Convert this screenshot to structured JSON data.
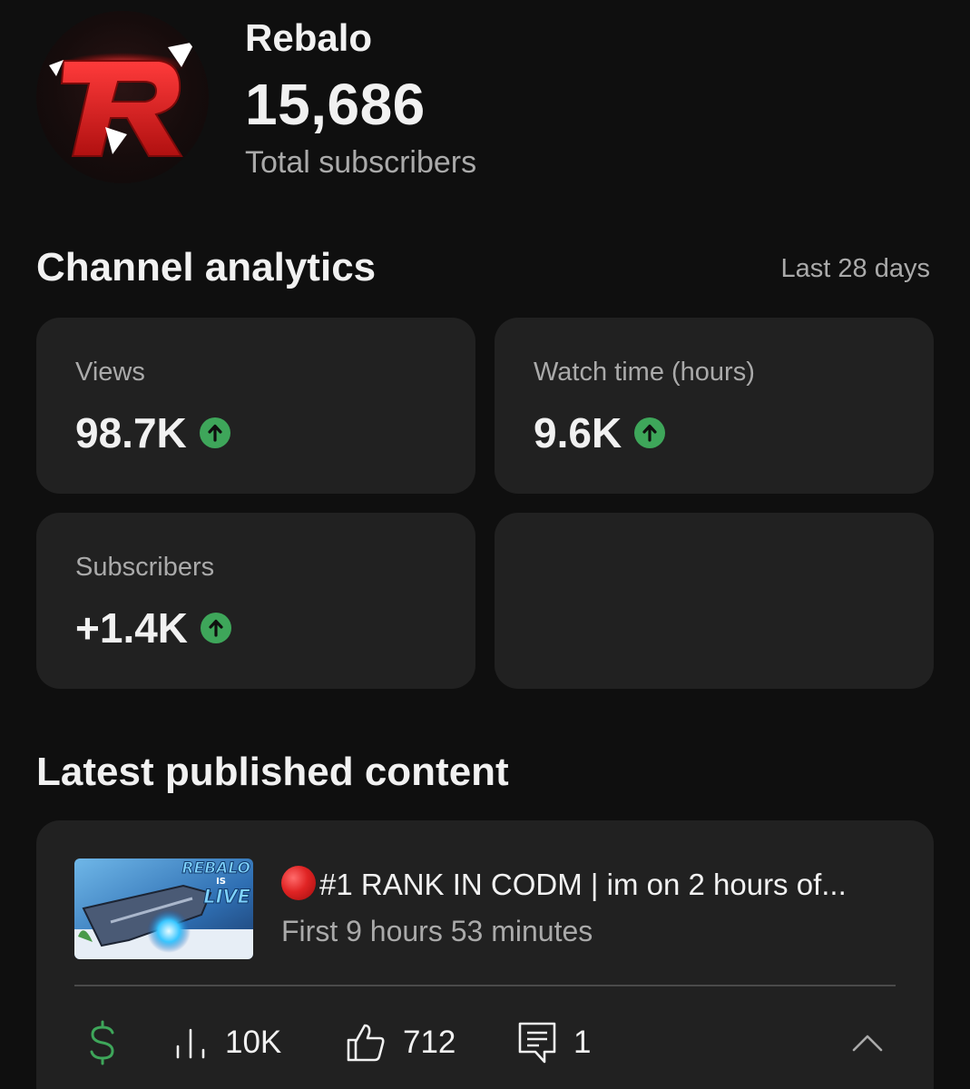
{
  "channel": {
    "name": "Rebalo",
    "subscriber_count": "15,686",
    "subscriber_label": "Total subscribers",
    "avatar_letter": "R"
  },
  "analytics": {
    "title": "Channel analytics",
    "range": "Last 28 days",
    "cards": [
      {
        "label": "Views",
        "value": "98.7K",
        "trend": "up"
      },
      {
        "label": "Watch time (hours)",
        "value": "9.6K",
        "trend": "up"
      },
      {
        "label": "Subscribers",
        "value": "+1.4K",
        "trend": "up"
      }
    ]
  },
  "latest": {
    "title": "Latest published content",
    "video": {
      "thumbnail_text": [
        "REBALO",
        "IS",
        "LIVE"
      ],
      "title": "#1 RANK IN CODM | im on 2 hours of...",
      "subtitle": "First 9 hours 53 minutes",
      "views": "10K",
      "likes": "712",
      "comments": "1"
    }
  },
  "colors": {
    "background": "#0f0f0f",
    "card": "#212121",
    "trend_up": "#3ea65a",
    "monetization": "#3ea65a",
    "live": "#e02424"
  },
  "icons": [
    "up-arrow-icon",
    "dollar-icon",
    "bar-chart-icon",
    "thumbs-up-icon",
    "comment-icon",
    "chevron-up-icon"
  ]
}
